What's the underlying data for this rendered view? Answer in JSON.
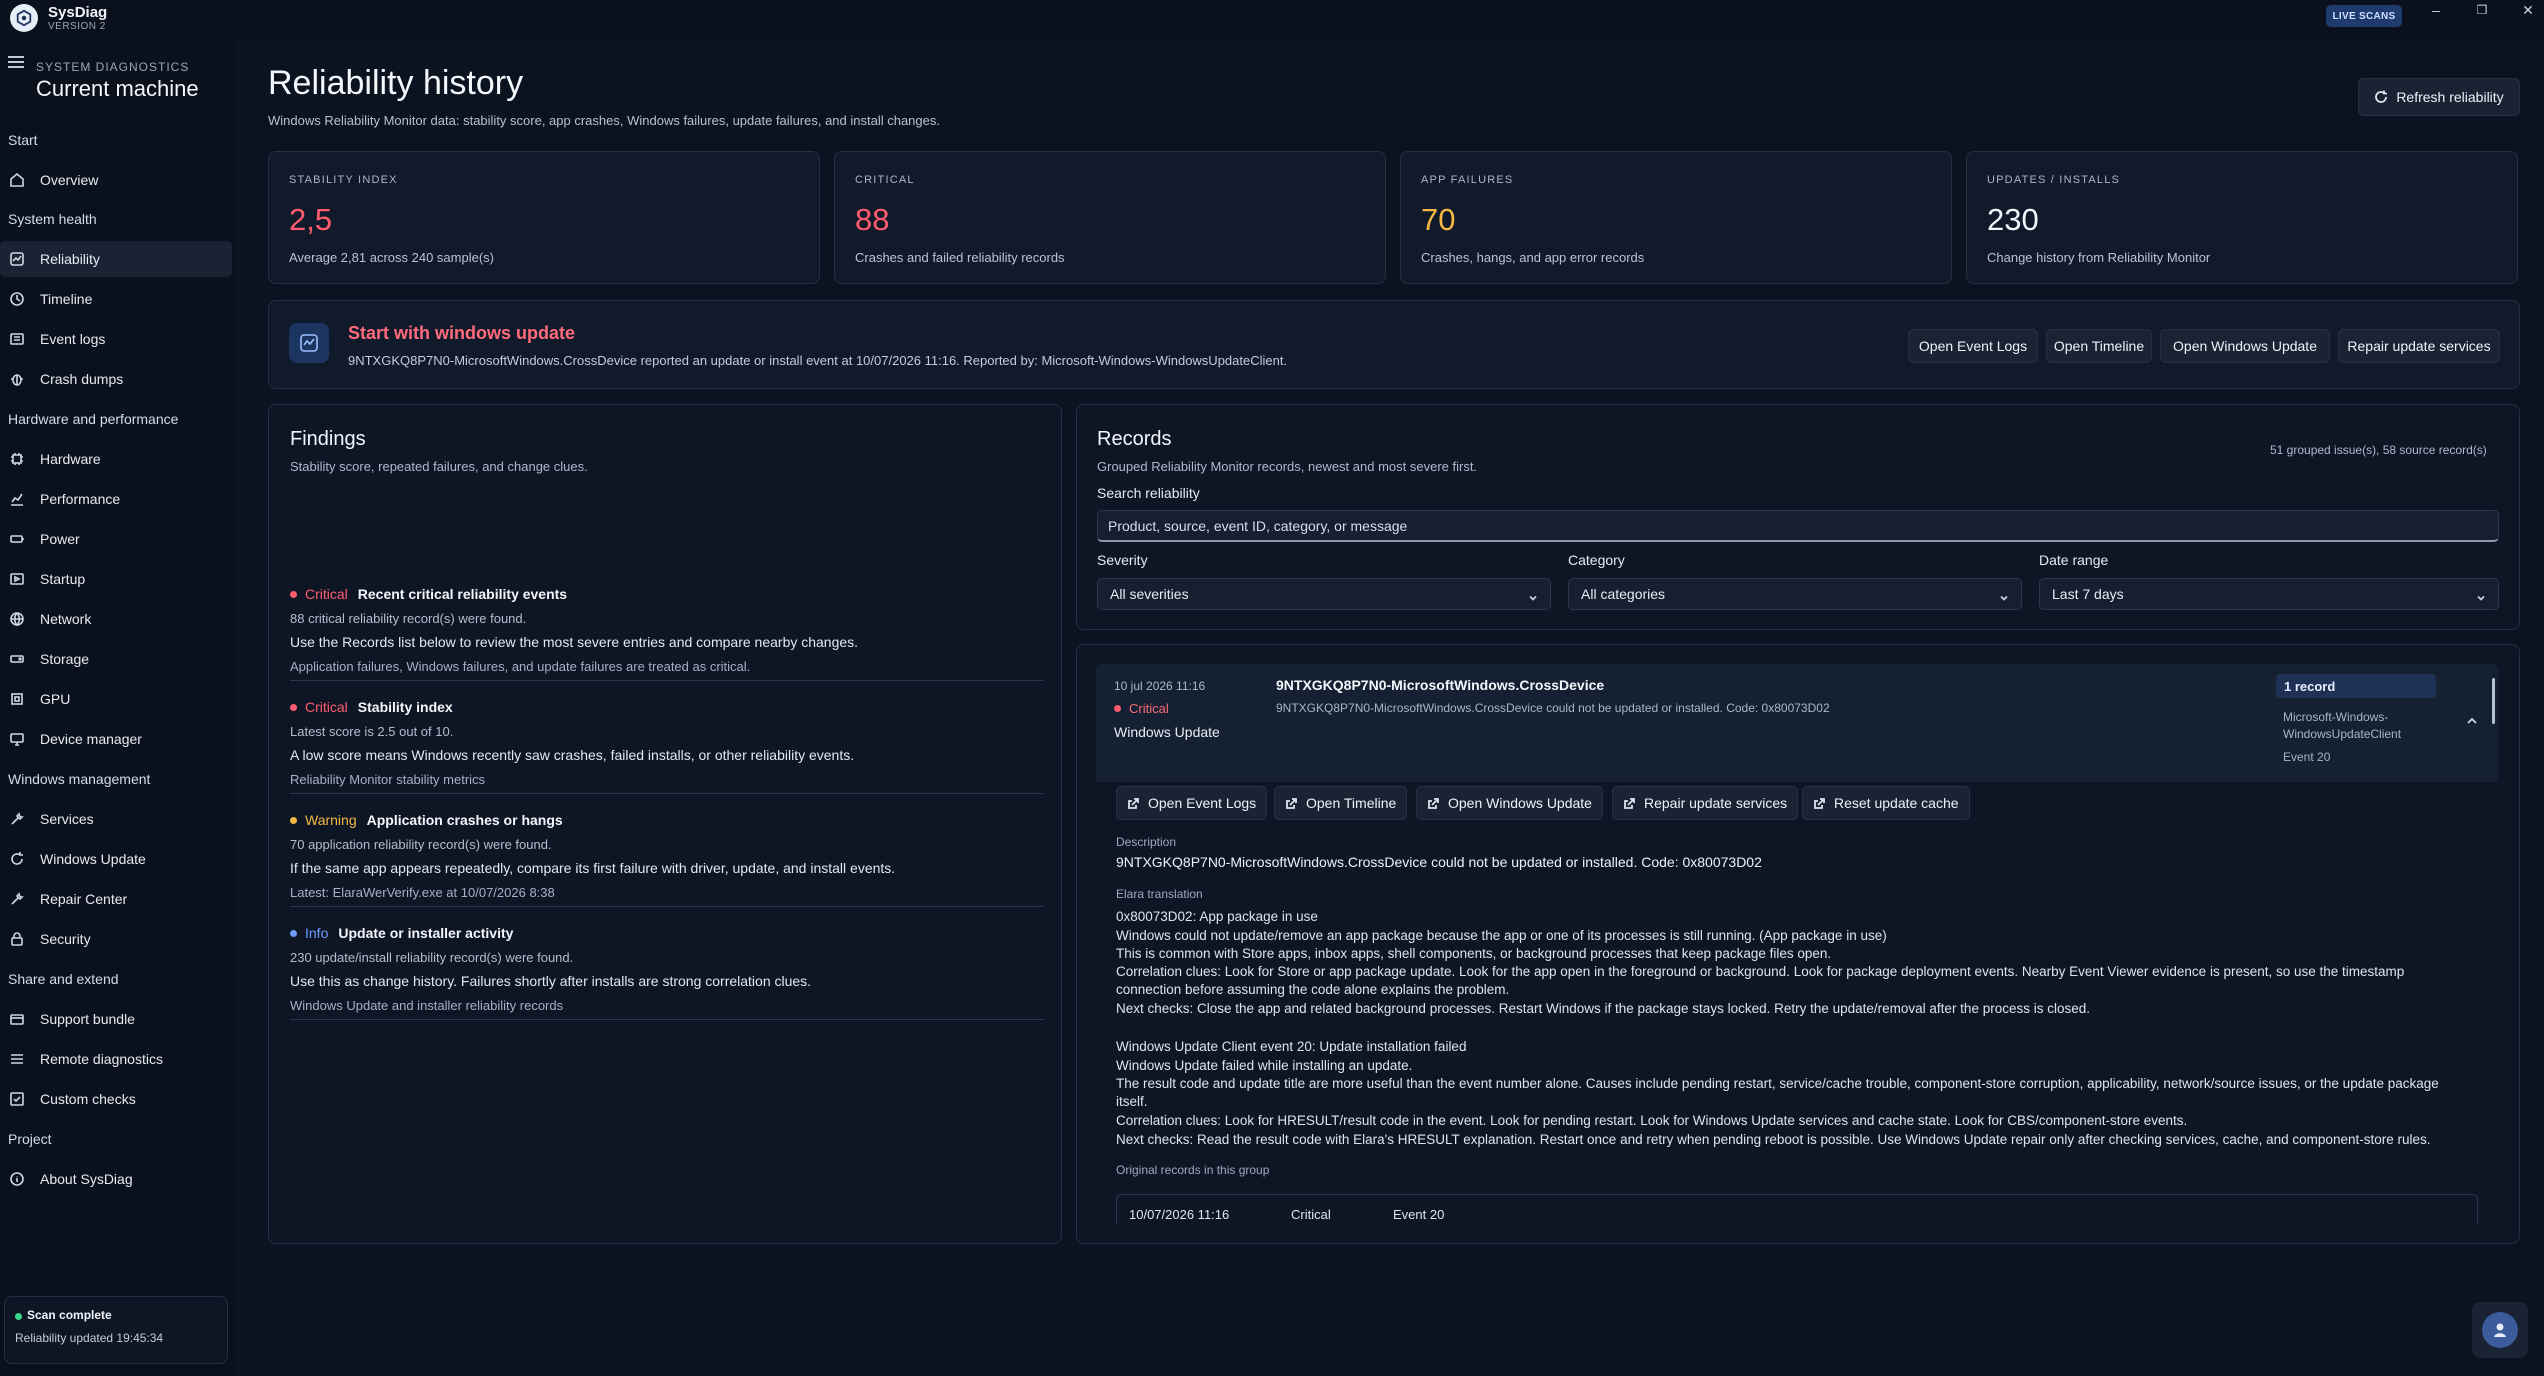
{
  "app": {
    "name": "SysDiag",
    "version": "VERSION 2",
    "live_badge": "LIVE SCANS"
  },
  "window_controls": {
    "minimize": "–",
    "maximize": "❐",
    "close": "✕"
  },
  "sidebar": {
    "eyebrow": "SYSTEM DIAGNOSTICS",
    "title": "Current machine",
    "sections": {
      "start": "Start",
      "system_health": "System health",
      "hardware": "Hardware and performance",
      "windows_management": "Windows management",
      "share": "Share and extend",
      "project": "Project"
    },
    "items": {
      "overview": "Overview",
      "reliability": "Reliability",
      "timeline": "Timeline",
      "event_logs": "Event logs",
      "crash_dumps": "Crash dumps",
      "hardware": "Hardware",
      "performance": "Performance",
      "power": "Power",
      "startup": "Startup",
      "network": "Network",
      "storage": "Storage",
      "gpu": "GPU",
      "device_manager": "Device manager",
      "services": "Services",
      "windows_update": "Windows Update",
      "repair_center": "Repair Center",
      "security": "Security",
      "support_bundle": "Support bundle",
      "remote_diagnostics": "Remote diagnostics",
      "custom_checks": "Custom checks",
      "about": "About SysDiag"
    },
    "status": {
      "title": "Scan complete",
      "subtitle": "Reliability updated 19:45:34"
    }
  },
  "header": {
    "title": "Reliability history",
    "subtitle": "Windows Reliability Monitor data: stability score, app crashes, Windows failures, update failures, and install changes.",
    "refresh_button": "Refresh reliability"
  },
  "stats": [
    {
      "label": "STABILITY INDEX",
      "value": "2,5",
      "note": "Average 2,81 across 240 sample(s)",
      "color": "#ff5d6e"
    },
    {
      "label": "CRITICAL",
      "value": "88",
      "note": "Crashes and failed reliability records",
      "color": "#ff5d6e"
    },
    {
      "label": "APP FAILURES",
      "value": "70",
      "note": "Crashes, hangs, and app error records",
      "color": "#f5b843"
    },
    {
      "label": "UPDATES / INSTALLS",
      "value": "230",
      "note": "Change history from Reliability Monitor",
      "color": "#f2f5fa"
    }
  ],
  "banner": {
    "title": "Start with windows update",
    "text": "9NTXGKQ8P7N0-MicrosoftWindows.CrossDevice reported an update or install event at 10/07/2026 11:16. Reported by: Microsoft-Windows-WindowsUpdateClient.",
    "buttons": [
      "Open Event Logs",
      "Open Timeline",
      "Open Windows Update",
      "Repair update services"
    ]
  },
  "findings": {
    "title": "Findings",
    "subtitle": "Stability score, repeated failures, and change clues.",
    "items": [
      {
        "severity": "Critical",
        "title": "Recent critical reliability events",
        "line1": "88 critical reliability record(s) were found.",
        "line2": "Use the Records list below to review the most severe entries and compare nearby changes.",
        "line3": "Application failures, Windows failures, and update failures are treated as critical.",
        "color": "#ff5d6e"
      },
      {
        "severity": "Critical",
        "title": "Stability index",
        "line1": "Latest score is 2.5 out of 10.",
        "line2": "A low score means Windows recently saw crashes, failed installs, or other reliability events.",
        "line3": "Reliability Monitor stability metrics",
        "color": "#ff5d6e"
      },
      {
        "severity": "Warning",
        "title": "Application crashes or hangs",
        "line1": "70 application reliability record(s) were found.",
        "line2": "If the same app appears repeatedly, compare its first failure with driver, update, and install events.",
        "line3": "Latest: ElaraWerVerify.exe at 10/07/2026 8:38",
        "color": "#f5b843"
      },
      {
        "severity": "Info",
        "title": "Update or installer activity",
        "line1": "230 update/install reliability record(s) were found.",
        "line2": "Use this as change history. Failures shortly after installs are strong correlation clues.",
        "line3": "Windows Update and installer reliability records",
        "color": "#6f9cff"
      }
    ]
  },
  "records": {
    "title": "Records",
    "subtitle": "Grouped Reliability Monitor records, newest and most severe first.",
    "count": "51 grouped issue(s), 58 source record(s)",
    "search_label": "Search reliability",
    "search_placeholder": "Product, source, event ID, category, or message",
    "filters": {
      "severity_label": "Severity",
      "severity_value": "All severities",
      "category_label": "Category",
      "category_value": "All categories",
      "date_label": "Date range",
      "date_value": "Last 7 days"
    }
  },
  "record": {
    "date": "10 jul 2026 11:16",
    "severity": "Critical",
    "source": "Windows Update",
    "title": "9NTXGKQ8P7N0-MicrosoftWindows.CrossDevice",
    "message": "9NTXGKQ8P7N0-MicrosoftWindows.CrossDevice could not be updated or installed. Code: 0x80073D02",
    "count": "1 record",
    "provider": "Microsoft-Windows-WindowsUpdateClient",
    "event": "Event 20",
    "actions": [
      "Open Event Logs",
      "Open Timeline",
      "Open Windows Update",
      "Repair update services",
      "Reset update cache"
    ],
    "description_label": "Description",
    "description": "9NTXGKQ8P7N0-MicrosoftWindows.CrossDevice could not be updated or installed. Code: 0x80073D02",
    "translation_label": "Elara translation",
    "translation": [
      "0x80073D02: App package in use",
      "Windows could not update/remove an app package because the app or one of its processes is still running. (App package in use)",
      "This is common with Store apps, inbox apps, shell components, or background processes that keep package files open.",
      "Correlation clues: Look for Store or app package update. Look for the app open in the foreground or background. Look for package deployment events. Nearby Event Viewer evidence is present, so use the timestamp connection before assuming the code alone explains the problem.",
      "Next checks: Close the app and related background processes. Restart Windows if the package stays locked. Retry the update/removal after the process is closed.",
      "",
      "Windows Update Client event 20: Update installation failed",
      "Windows Update failed while installing an update.",
      "The result code and update title are more useful than the event number alone. Causes include pending restart, service/cache trouble, component-store corruption, applicability, network/source issues, or the update package itself.",
      "Correlation clues: Look for HRESULT/result code in the event. Look for pending restart. Look for Windows Update services and cache state. Look for CBS/component-store events.",
      "Next checks: Read the result code with Elara's HRESULT explanation. Restart once and retry when pending reboot is possible. Use Windows Update repair only after checking services, cache, and component-store rules."
    ],
    "original_label": "Original records in this group",
    "original_row": {
      "time": "10/07/2026 11:16",
      "severity": "Critical",
      "event": "Event 20"
    }
  }
}
